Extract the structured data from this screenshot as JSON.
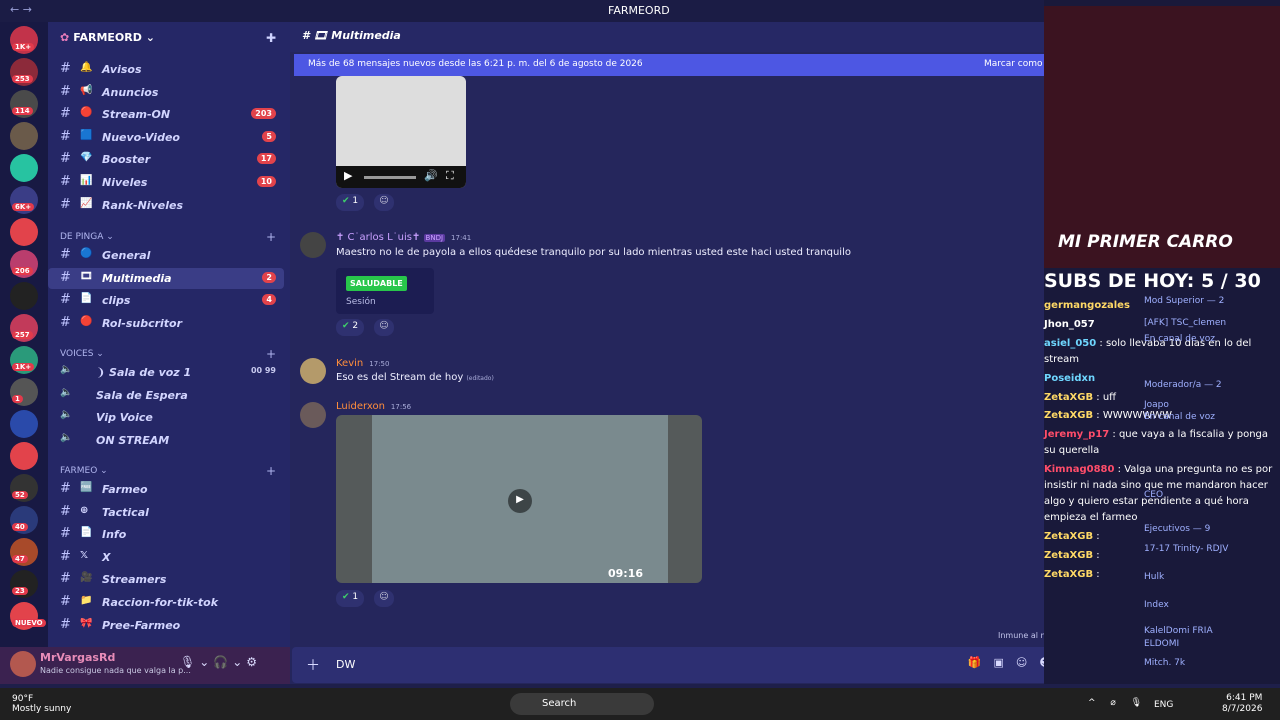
{
  "window": {
    "title": "FARMEORD",
    "nav": "← →"
  },
  "servers": [
    {
      "badge": "1K+",
      "color": "#c2334a"
    },
    {
      "badge": "253",
      "color": "#8c2a3a"
    },
    {
      "badge": "114",
      "color": "#4a4a4a"
    },
    {
      "badge": "",
      "color": "#6a5a4a"
    },
    {
      "badge": "",
      "color": "#27c3a1"
    },
    {
      "badge": "6K+",
      "color": "#3a3d86"
    },
    {
      "badge": "",
      "color": "#e2434b"
    },
    {
      "badge": "206",
      "color": "#ba3d6d"
    },
    {
      "badge": "",
      "color": "#222"
    },
    {
      "badge": "257",
      "color": "#c23a5a"
    },
    {
      "badge": "1K+",
      "color": "#2a9a7a"
    },
    {
      "badge": "1",
      "color": "#555"
    },
    {
      "badge": "",
      "color": "#2a4aaa"
    },
    {
      "badge": "",
      "color": "#e2434b"
    },
    {
      "badge": "52",
      "color": "#333"
    },
    {
      "badge": "40",
      "color": "#2a3a7a"
    },
    {
      "badge": "47",
      "color": "#a84a2a"
    },
    {
      "badge": "23",
      "color": "#222"
    },
    {
      "badge": "NUEVO",
      "color": "#e2434b"
    }
  ],
  "guild": {
    "name": "FARMEORD ⌄"
  },
  "channels": [
    {
      "emoji": "🔔",
      "name": "Avisos",
      "count": ""
    },
    {
      "emoji": "📢",
      "name": "Anuncios",
      "count": ""
    },
    {
      "emoji": "🔴",
      "name": "Stream-ON",
      "count": "203"
    },
    {
      "emoji": "🟦",
      "name": "Nuevo-Video",
      "count": "5"
    },
    {
      "emoji": "💎",
      "name": "Booster",
      "count": "17"
    },
    {
      "emoji": "📊",
      "name": "Niveles",
      "count": "10"
    },
    {
      "emoji": "📈",
      "name": "Rank-Niveles",
      "count": ""
    }
  ],
  "cat1": {
    "name": "DE PINGA ⌄"
  },
  "channels2": [
    {
      "emoji": "🔵",
      "name": "General",
      "count": ""
    },
    {
      "emoji": "🎞",
      "name": "Multimedia",
      "count": "2"
    },
    {
      "emoji": "📄",
      "name": "clips",
      "count": "4"
    },
    {
      "emoji": "🔴",
      "name": "Rol-subcritor",
      "count": ""
    }
  ],
  "voices": {
    "name": "VOICES ⌄"
  },
  "voice_channels": [
    {
      "name": "❩ Sala de voz 1",
      "extra": "00  99"
    },
    {
      "name": "Sala de Espera",
      "extra": ""
    },
    {
      "name": "Vip Voice",
      "extra": ""
    },
    {
      "name": "ON STREAM",
      "extra": ""
    }
  ],
  "cat2": {
    "name": "FARMEO ⌄"
  },
  "channels3": [
    {
      "emoji": "🆓",
      "name": "Farmeo",
      "count": ""
    },
    {
      "emoji": "⊕",
      "name": "Tactical",
      "count": ""
    },
    {
      "emoji": "📄",
      "name": "Info",
      "count": ""
    },
    {
      "emoji": "𝕏",
      "name": "X",
      "count": ""
    },
    {
      "emoji": "🎥",
      "name": "Streamers",
      "count": ""
    },
    {
      "emoji": "📁",
      "name": "Raccion-for-tik-tok",
      "count": ""
    },
    {
      "emoji": "🎀",
      "name": "Pree-Farmeo",
      "count": ""
    }
  ],
  "user": {
    "name": "MrVargasRd",
    "status": "Nadie consigue nada que valga la p..."
  },
  "main": {
    "channel": "Multimedia",
    "banner_left": "Más de 68 mensajes nuevos desde las 6:21 p. m. del 6 de agosto de 2026",
    "banner_right": "Marcar como l",
    "messages": [
      {
        "author": "✝ C˙arlos L˙uis✝",
        "tag": "BNDJ",
        "time": "17:41",
        "text": "Maestro no le de payola a ellos quédese tranquilo por su lado mientras usted este haci usted tranquilo",
        "color": "#c9a0ff"
      },
      {
        "author": "Kevin",
        "tag": "",
        "time": "17:50",
        "text": "Eso es del Stream de hoy",
        "color": "#ff8e3c"
      },
      {
        "author": "Luiderxon",
        "tag": "",
        "time": "17:56",
        "text": "",
        "color": "#ff8e3c"
      }
    ],
    "edited": "(editado)",
    "pill_button": "SALUDABLE",
    "pill_session": "Sesión",
    "reactions": [
      "1",
      "2",
      "1"
    ],
    "video_time": "09:16",
    "immune": "Inmune al modo pausado"
  },
  "composer": {
    "value": "DW"
  },
  "stream": {
    "cam_title": "MI PRIMER CARRO",
    "subs": "SUBS DE HOY: 5 / 30",
    "chat": [
      {
        "user": "germangozales",
        "text": "",
        "color": "#ffd966"
      },
      {
        "user": "Jhon_057",
        "text": "",
        "color": "#ffffff"
      },
      {
        "user": "asiel_050",
        "text": ": solo llevaba 10 dias en lo del stream",
        "color": "#6fd7ff"
      },
      {
        "user": "Poseidxn",
        "text": "",
        "color": "#6fd7ff"
      },
      {
        "user": "ZetaXGB",
        "text": ": uff",
        "color": "#ffd966"
      },
      {
        "user": "ZetaXGB",
        "text": ": WWWWWWW",
        "color": "#ffd966"
      },
      {
        "user": "Jeremy_p17",
        "text": ": que vaya a la fiscalia y ponga su querella",
        "color": "#ff4d6a"
      },
      {
        "user": "Kimnag0880",
        "text": ": Valga una pregunta no es por insistir ni nada sino que me mandaron hacer algo y quiero estar pendiente a qué hora empieza el farmeo",
        "color": "#ff4d6a"
      },
      {
        "user": "ZetaXGB",
        "text": ":",
        "color": "#ffd966"
      },
      {
        "user": "ZetaXGB",
        "text": ":",
        "color": "#ffd966"
      },
      {
        "user": "ZetaXGB",
        "text": ":",
        "color": "#ffd966"
      }
    ],
    "members": [
      "Mod Superior — 2",
      "[AFK] TSC_clemen",
      "En canal de voz",
      "Moderador/a — 2",
      "Joapo",
      "En canal de voz",
      "CEO",
      "Ejecutivos — 9",
      "17-17 Trinity-  RDJV",
      "Hulk",
      "Index",
      "KalelDomi  FRIA",
      "ELDOMI",
      "Mitch.  7k"
    ]
  },
  "taskbar": {
    "temp": "90°F",
    "weather": "Mostly sunny",
    "search": "Search",
    "lang": "ENG",
    "time": "6:41 PM",
    "date": "8/7/2026"
  }
}
